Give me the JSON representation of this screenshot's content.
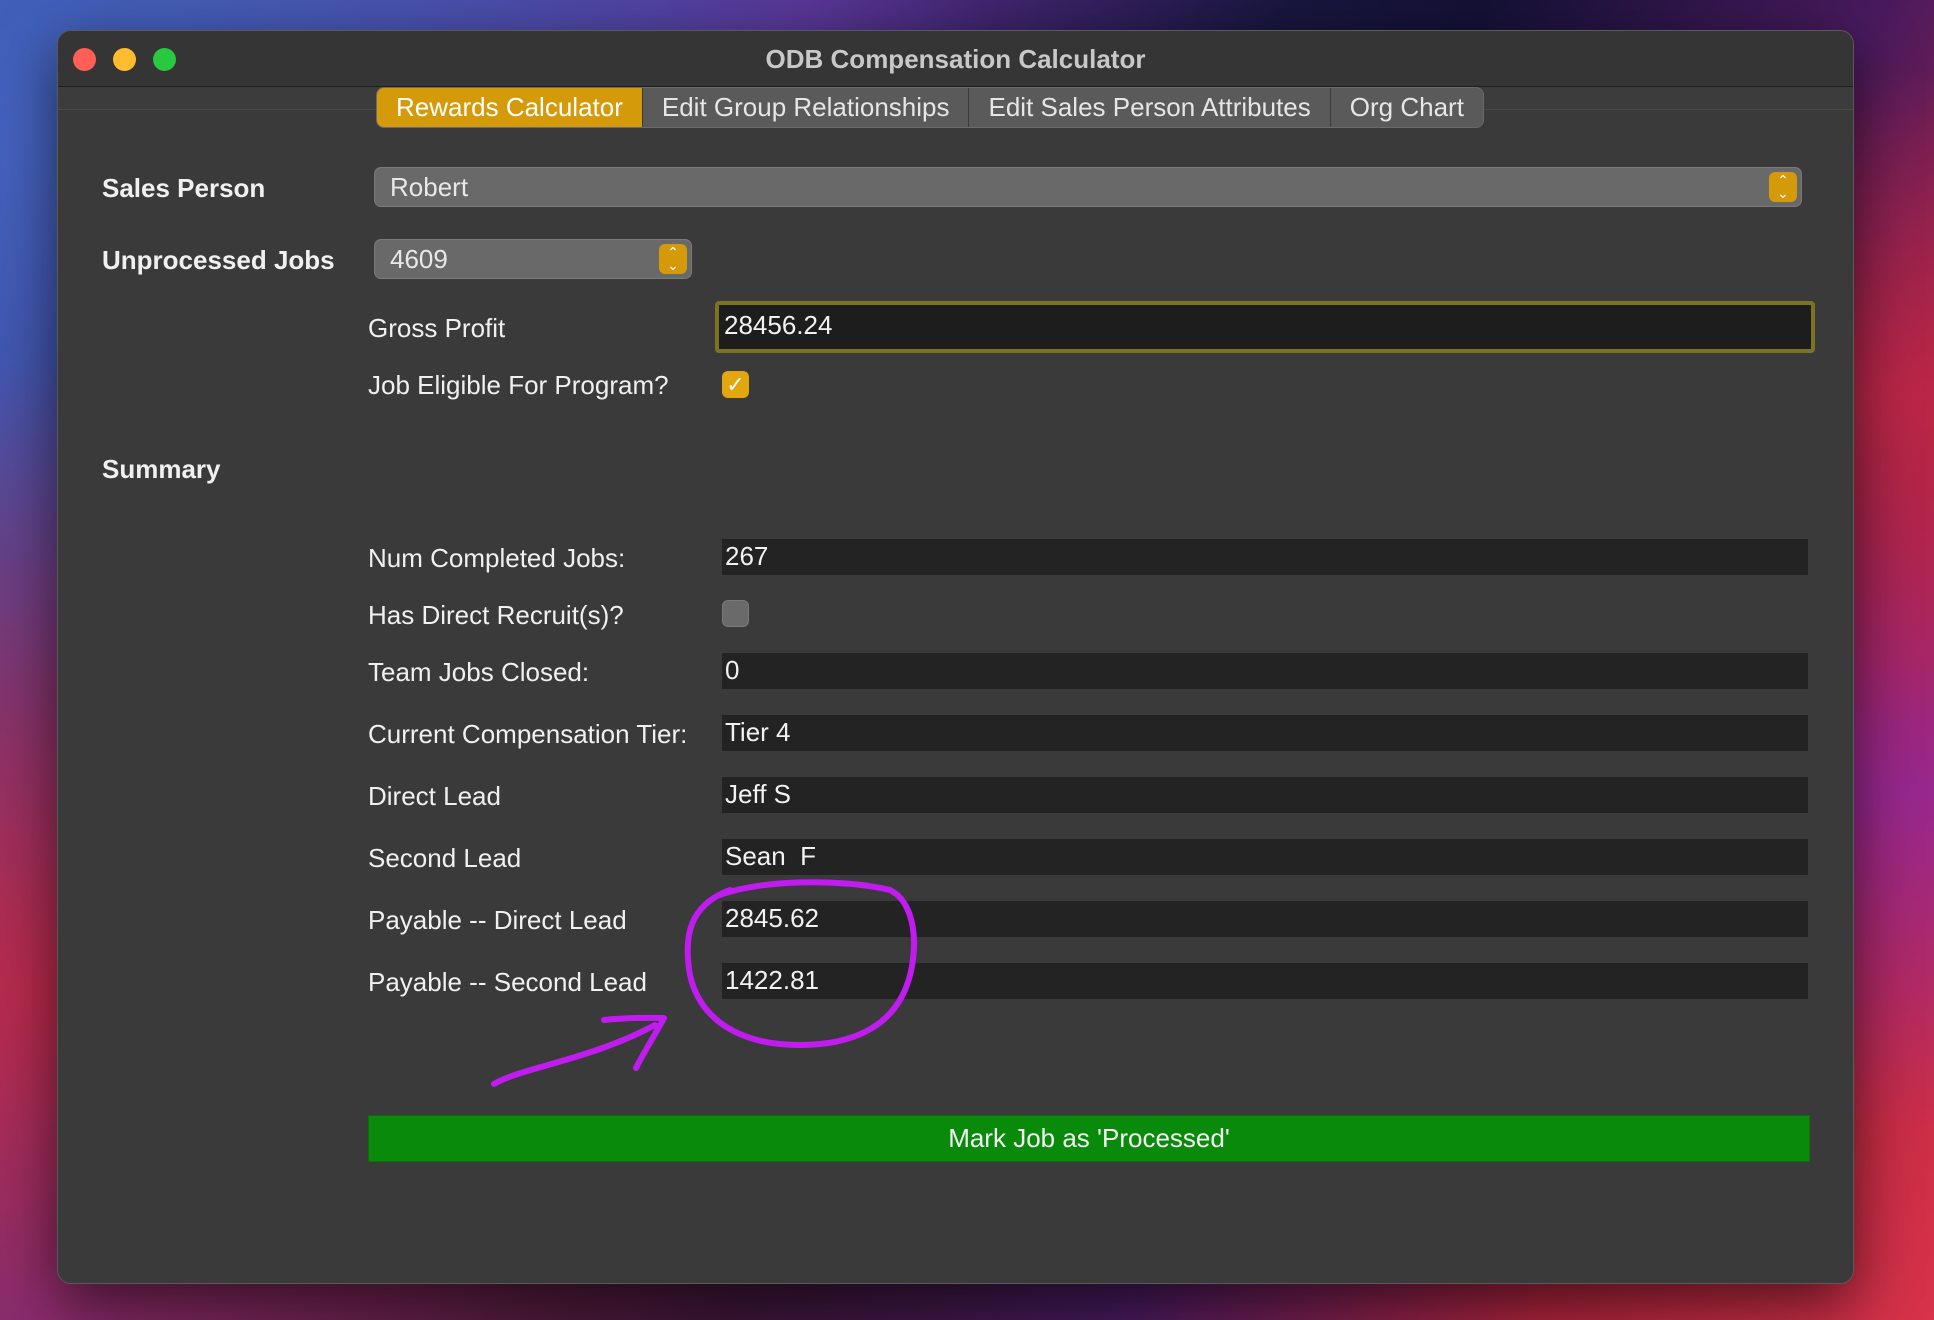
{
  "window": {
    "title": "ODB Compensation Calculator"
  },
  "tabs": [
    {
      "label": "Rewards Calculator",
      "active": true
    },
    {
      "label": "Edit Group Relationships",
      "active": false
    },
    {
      "label": "Edit Sales Person Attributes",
      "active": false
    },
    {
      "label": "Org Chart",
      "active": false
    }
  ],
  "form": {
    "sales_person_label": "Sales Person",
    "sales_person_value": "Robert",
    "unprocessed_jobs_label": "Unprocessed Jobs",
    "unprocessed_jobs_value": "4609",
    "gross_profit_label": "Gross Profit",
    "gross_profit_value": "28456.24",
    "eligible_label": "Job Eligible For Program?",
    "eligible_checked": true
  },
  "summary": {
    "heading": "Summary",
    "num_completed_label": "Num Completed Jobs:",
    "num_completed_value": "267",
    "has_recruits_label": "Has Direct Recruit(s)?",
    "has_recruits_checked": false,
    "team_jobs_label": "Team Jobs Closed:",
    "team_jobs_value": "0",
    "tier_label": "Current Compensation Tier:",
    "tier_value": "Tier 4",
    "direct_lead_label": "Direct Lead",
    "direct_lead_value": "Jeff S",
    "second_lead_label": "Second Lead",
    "second_lead_value": "Sean  F",
    "payable_direct_label": "Payable -- Direct Lead",
    "payable_direct_value": "2845.62",
    "payable_second_label": "Payable -- Second Lead",
    "payable_second_value": "1422.81"
  },
  "actions": {
    "mark_processed_label": "Mark Job as 'Processed'"
  },
  "colors": {
    "accent": "#d49a0a",
    "button_green": "#0a8a0a",
    "annotation": "#c01cf0"
  }
}
